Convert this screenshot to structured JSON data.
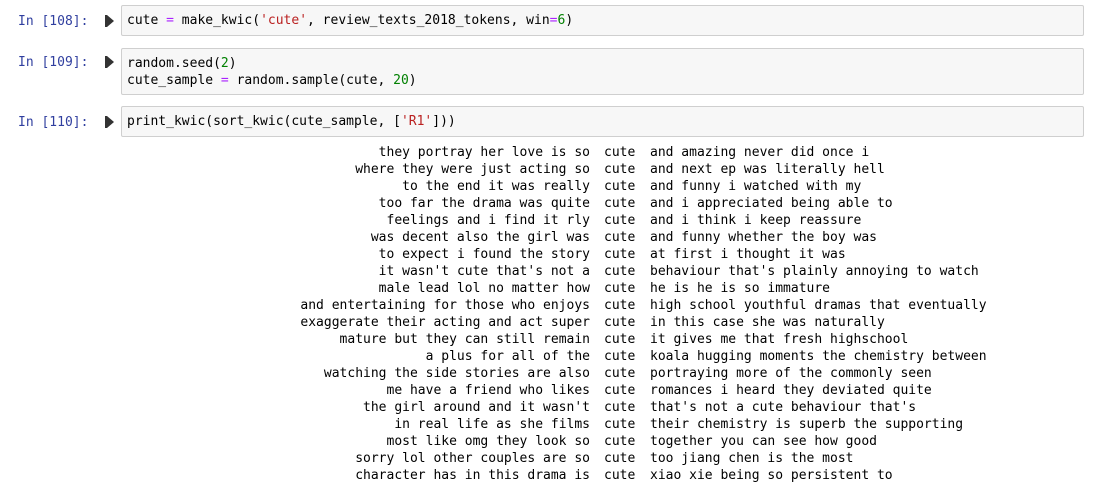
{
  "cells": [
    {
      "prompt": "In [108]:",
      "lines": [
        [
          {
            "t": "cute ",
            "c": ""
          },
          {
            "t": "=",
            "c": "op"
          },
          {
            "t": " make_kwic(",
            "c": ""
          },
          {
            "t": "'cute'",
            "c": "str"
          },
          {
            "t": ", review_texts_2018_tokens, win",
            "c": ""
          },
          {
            "t": "=",
            "c": "op"
          },
          {
            "t": "6",
            "c": "num"
          },
          {
            "t": ")",
            "c": ""
          }
        ]
      ]
    },
    {
      "prompt": "In [109]:",
      "lines": [
        [
          {
            "t": "random.seed(",
            "c": ""
          },
          {
            "t": "2",
            "c": "num"
          },
          {
            "t": ")",
            "c": ""
          }
        ],
        [
          {
            "t": "cute_sample ",
            "c": ""
          },
          {
            "t": "=",
            "c": "op"
          },
          {
            "t": " random.sample(cute, ",
            "c": ""
          },
          {
            "t": "20",
            "c": "num"
          },
          {
            "t": ")",
            "c": ""
          }
        ]
      ]
    },
    {
      "prompt": "In [110]:",
      "lines": [
        [
          {
            "t": "print_kwic(sort_kwic(cute_sample, [",
            "c": ""
          },
          {
            "t": "'R1'",
            "c": "str"
          },
          {
            "t": "]))",
            "c": ""
          }
        ]
      ]
    }
  ],
  "output": {
    "keyword": "cute",
    "rows": [
      {
        "left": "they portray her love is so",
        "right": "and amazing never did once i"
      },
      {
        "left": "where they were just acting so",
        "right": "and next ep was literally hell"
      },
      {
        "left": "to the end it was really",
        "right": "and funny i watched with my"
      },
      {
        "left": "too far the drama was quite",
        "right": "and i appreciated being able to"
      },
      {
        "left": "feelings and i find it rly",
        "right": "and i think i keep reassure"
      },
      {
        "left": "was decent also the girl was",
        "right": "and funny whether the boy was"
      },
      {
        "left": "to expect i found the story",
        "right": "at first i thought it was"
      },
      {
        "left": "it wasn't cute that's not a",
        "right": "behaviour that's plainly annoying to watch"
      },
      {
        "left": "male lead lol no matter how",
        "right": "he is he is so immature"
      },
      {
        "left": "and entertaining for those who enjoys",
        "right": "high school youthful dramas that eventually"
      },
      {
        "left": "exaggerate their acting and act super",
        "right": "in this case she was naturally"
      },
      {
        "left": "mature but they can still remain",
        "right": "it gives me that fresh highschool"
      },
      {
        "left": "a plus for all of the",
        "right": "koala hugging moments the chemistry between"
      },
      {
        "left": "watching the side stories are also",
        "right": "portraying more of the commonly seen"
      },
      {
        "left": "me have a friend who likes",
        "right": "romances i heard they deviated quite"
      },
      {
        "left": "the girl around and it wasn't",
        "right": "that's not a cute behaviour that's"
      },
      {
        "left": "in real life as she films",
        "right": "their chemistry is superb the supporting"
      },
      {
        "left": "most like omg they look so",
        "right": "together you can see how good"
      },
      {
        "left": "sorry lol other couples are so",
        "right": "too jiang chen is the most"
      },
      {
        "left": "character has in this drama is",
        "right": "xiao xie being so persistent to"
      }
    ]
  }
}
